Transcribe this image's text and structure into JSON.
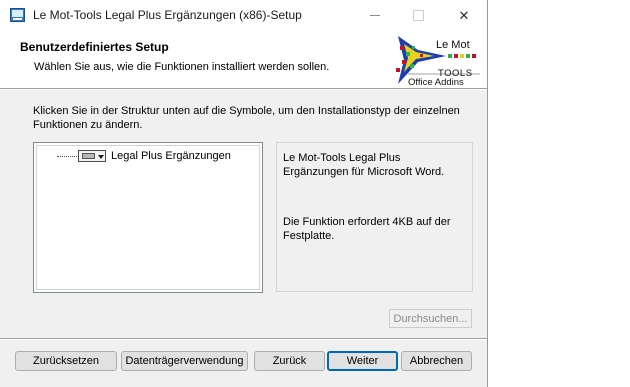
{
  "window": {
    "title": "Le Mot-Tools Legal Plus Ergänzungen (x86)-Setup",
    "minimize_label": "—",
    "close_label": "✕"
  },
  "header": {
    "title": "Benutzerdefiniertes Setup",
    "subtitle": "Wählen Sie aus, wie die Funktionen installiert werden sollen.",
    "logo": {
      "line1": "Le Mot",
      "line2": "TOOLS",
      "line3": "Office Addins"
    }
  },
  "instruction": "Klicken Sie in der Struktur unten auf die Symbole, um den Installationstyp der einzelnen Funktionen zu ändern.",
  "tree": {
    "items": [
      {
        "label": "Legal Plus Ergänzungen",
        "icon": "hard-drive-icon"
      }
    ]
  },
  "description": {
    "text": "Le Mot-Tools Legal Plus Ergänzungen für Microsoft Word.",
    "size_text": "Die Funktion erfordert 4KB auf der Festplatte."
  },
  "buttons": {
    "browse": "Durchsuchen...",
    "reset": "Zurücksetzen",
    "disk_usage": "Datenträgerverwendung",
    "back": "Zurück",
    "next": "Weiter",
    "cancel": "Abbrechen"
  },
  "colors": {
    "accent": "#0067c0",
    "window_bg": "#f0f0f0"
  }
}
